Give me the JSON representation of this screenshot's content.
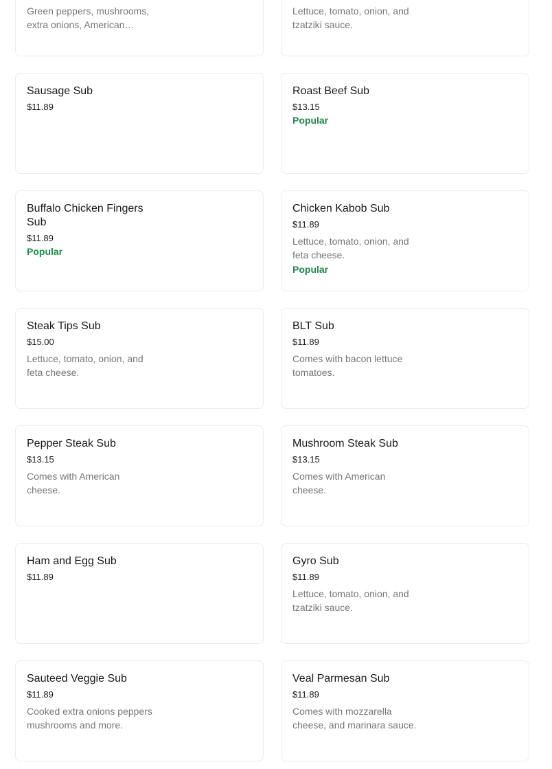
{
  "menu": {
    "items": [
      {
        "title": "",
        "price": "",
        "desc": "Green peppers, mushrooms, extra onions, American cheese.",
        "badge": ""
      },
      {
        "title": "",
        "price": "",
        "desc": "Lettuce, tomato, onion, and tzatziki sauce.",
        "badge": ""
      },
      {
        "title": "Sausage Sub",
        "price": "$11.89",
        "desc": "",
        "badge": ""
      },
      {
        "title": "Roast Beef Sub",
        "price": "$13.15",
        "desc": "",
        "badge": "Popular"
      },
      {
        "title": "Buffalo Chicken Fingers Sub",
        "price": "$11.89",
        "desc": "",
        "badge": "Popular"
      },
      {
        "title": "Chicken Kabob Sub",
        "price": "$11.89",
        "desc": "Lettuce, tomato, onion, and feta cheese.",
        "badge": "Popular"
      },
      {
        "title": "Steak Tips Sub",
        "price": "$15.00",
        "desc": "Lettuce, tomato, onion, and feta cheese.",
        "badge": ""
      },
      {
        "title": "BLT Sub",
        "price": "$11.89",
        "desc": "Comes with bacon lettuce tomatoes.",
        "badge": ""
      },
      {
        "title": "Pepper Steak Sub",
        "price": "$13.15",
        "desc": "Comes with American cheese.",
        "badge": ""
      },
      {
        "title": "Mushroom Steak Sub",
        "price": "$13.15",
        "desc": "Comes with American cheese.",
        "badge": ""
      },
      {
        "title": "Ham and Egg Sub",
        "price": "$11.89",
        "desc": "",
        "badge": ""
      },
      {
        "title": "Gyro Sub",
        "price": "$11.89",
        "desc": "Lettuce, tomato, onion, and tzatziki sauce.",
        "badge": ""
      },
      {
        "title": "Sauteed Veggie Sub",
        "price": "$11.89",
        "desc": "Cooked extra onions peppers mushrooms and more.",
        "badge": ""
      },
      {
        "title": "Veal Parmesan Sub",
        "price": "$11.89",
        "desc": "Comes with mozzarella cheese, and marinara sauce.",
        "badge": ""
      }
    ]
  },
  "colors": {
    "popular": "#1f8a4c",
    "desc": "#767676",
    "border": "#ececec"
  }
}
